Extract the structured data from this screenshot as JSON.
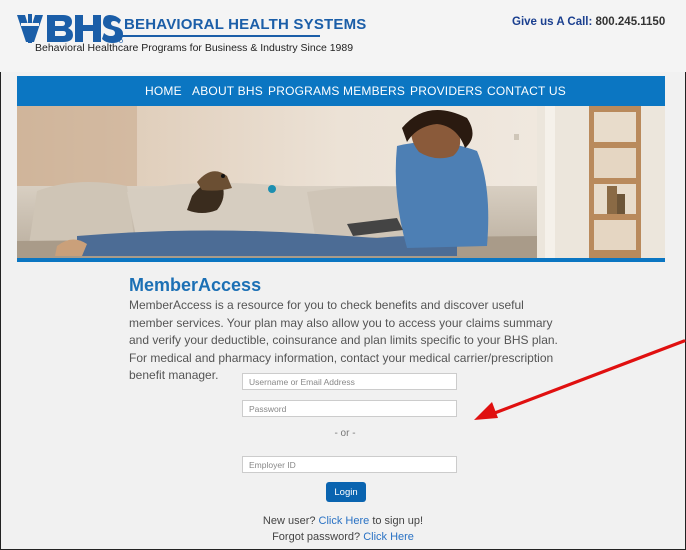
{
  "header": {
    "logo_text": "BHS",
    "brand": "BEHAVIORAL HEALTH SYSTEMS",
    "tagline": "Behavioral Healthcare Programs for Business & Industry Since 1989",
    "call_label": "Give us A Call:",
    "call_number": "800.245.1150"
  },
  "nav": {
    "items": [
      "HOME",
      "ABOUT BHS",
      "PROGRAMS",
      "MEMBERS",
      "PROVIDERS",
      "CONTACT US"
    ]
  },
  "main": {
    "title": "MemberAccess",
    "description": "MemberAccess is a resource for you to check benefits and discover useful member services. Your plan may also allow you to access your claims summary and verify your deductible, coinsurance and plan limits specific to your BHS plan. For medical and pharmacy information, contact your medical carrier/prescription benefit manager."
  },
  "form": {
    "username_placeholder": "Username or Email Address",
    "password_placeholder": "Password",
    "or_text": "- or -",
    "employer_placeholder": "Employer ID",
    "login_label": "Login",
    "new_user_prefix": "New user?",
    "new_user_link": "Click Here",
    "new_user_suffix": "to sign up!",
    "forgot_prefix": "Forgot password?",
    "forgot_link": "Click Here"
  },
  "colors": {
    "nav": "#0b76c2",
    "title": "#1c70b5",
    "link": "#2a72c4",
    "annotation_arrow": "#e01010"
  }
}
